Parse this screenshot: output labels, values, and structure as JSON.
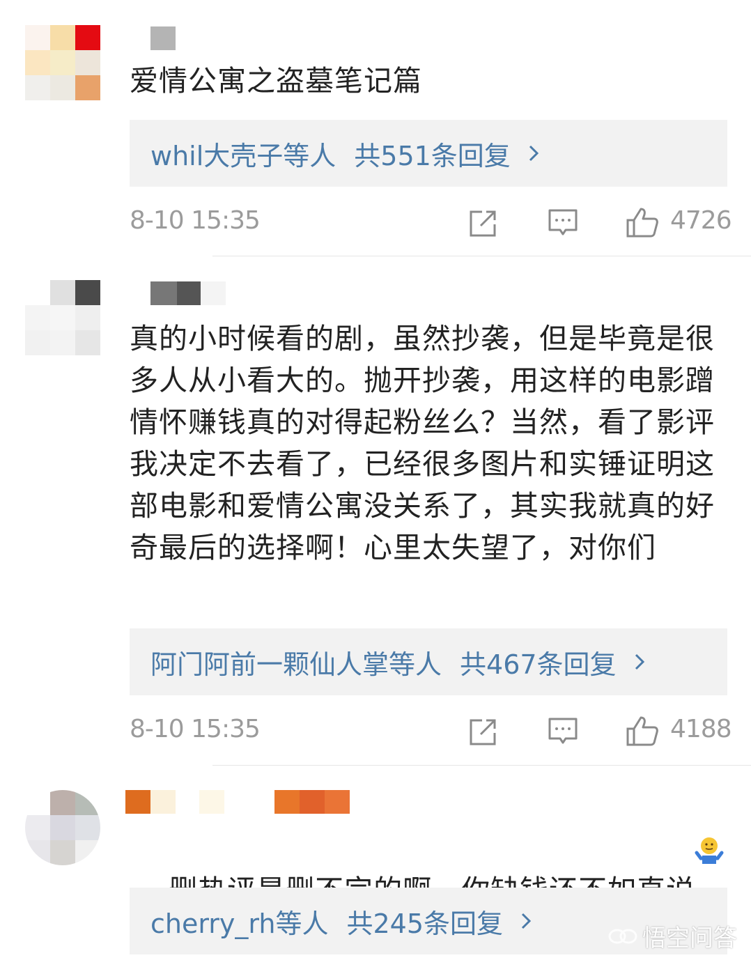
{
  "comments": [
    {
      "text": "爱情公寓之盗墓笔记篇",
      "replies": {
        "names": "whil大壳子等人",
        "count": "共551条回复"
      },
      "time": "8-10 15:35",
      "likes": "4726"
    },
    {
      "text": "真的小时候看的剧，虽然抄袭，但是毕竟是很多人从小看大的。抛开抄袭，用这样的电影蹭情怀赚钱真的对得起粉丝么？当然，看了影评我决定不去看了，已经很多图片和实锤证明这部电影和爱情公寓没关系了，其实我就真的好奇最后的选择啊！心里太失望了，对你们",
      "replies": {
        "names": "阿门阿前一颗仙人掌等人",
        "count": "共467条回复"
      },
      "time": "8-10 15:35",
      "likes": "4188"
    },
    {
      "text": "删热评是删不完的啊，你缺钱还不如直说",
      "replies": {
        "names": "cherry_rh等人",
        "count": "共245条回复"
      }
    }
  ],
  "icons": {
    "share": "share-icon",
    "comment": "comment-icon",
    "like": "thumbs-up-icon",
    "chevron": "chevron-right-icon",
    "emoji": "shrug-emoji-icon"
  },
  "colors": {
    "link": "#4a7aa8",
    "meta": "#9b9b9b",
    "reply_bg": "#f2f2f2"
  },
  "watermark": "悟空问答"
}
